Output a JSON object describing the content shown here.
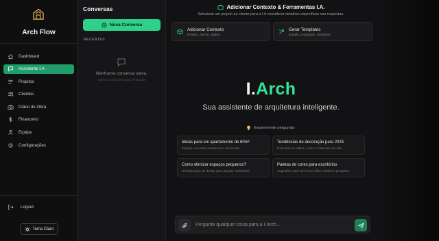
{
  "brand": {
    "name": "Arch Flow"
  },
  "nav": [
    {
      "label": "Dashboard",
      "icon": "home-icon"
    },
    {
      "label": "Assistente I.A",
      "icon": "chat-icon",
      "active": true
    },
    {
      "label": "Projetos",
      "icon": "list-icon"
    },
    {
      "label": "Clientes",
      "icon": "users-icon"
    },
    {
      "label": "Diário de Obra",
      "icon": "camera-icon"
    },
    {
      "label": "Financeiro",
      "icon": "dollar-icon"
    },
    {
      "label": "Equipe",
      "icon": "team-icon"
    },
    {
      "label": "Configurações",
      "icon": "gear-icon"
    }
  ],
  "sidebar": {
    "logout_label": "Logout",
    "theme_label": "Tema Claro"
  },
  "conversations": {
    "title": "Conversas",
    "new_label": "Nova Conversa",
    "recent_label": "RECENTES",
    "empty_title": "Nenhuma conversa salva.",
    "empty_sub": "Comece uma nova para vê-la aqui!"
  },
  "main": {
    "header_title": "Adicionar Contexto & Ferramentas I.A.",
    "header_sub": "Selecione um projeto ou cliente para a I.A considerar detalhes específicos nas respostas.",
    "tools": [
      {
        "title": "Adicionar Contexto",
        "sub": "Projeto, cliente, dados",
        "icon": "cube-icon"
      },
      {
        "title": "Gerar Templates",
        "sub": "Emails, propostas, relatórios",
        "icon": "tools-icon"
      }
    ],
    "hero_prefix": "I.",
    "hero_accent": "Arch",
    "tagline": "Sua assistente de arquitetura inteligente.",
    "try_label": "Experimente perguntar:",
    "suggestions": [
      {
        "title": "Ideias para um apartamento de 60m²",
        "sub": "Explore conceitos modernos e funcionais."
      },
      {
        "title": "Tendências de decoração para 2025",
        "sub": "Descubra os estilos, cores e materiais em alta."
      },
      {
        "title": "Como otimizar espaços pequenos?",
        "sub": "Receba dicas de design para ampliar ambientes."
      },
      {
        "title": "Paletas de cores para escritórios",
        "sub": "Sugestões para um home office criativo e produtivo."
      }
    ],
    "input_placeholder": "Pergunte qualquer coisa para a I.Arch..."
  },
  "colors": {
    "accent": "#2fd18a",
    "active_nav": "#1f9d6a",
    "hero_accent": "#34e39a"
  }
}
